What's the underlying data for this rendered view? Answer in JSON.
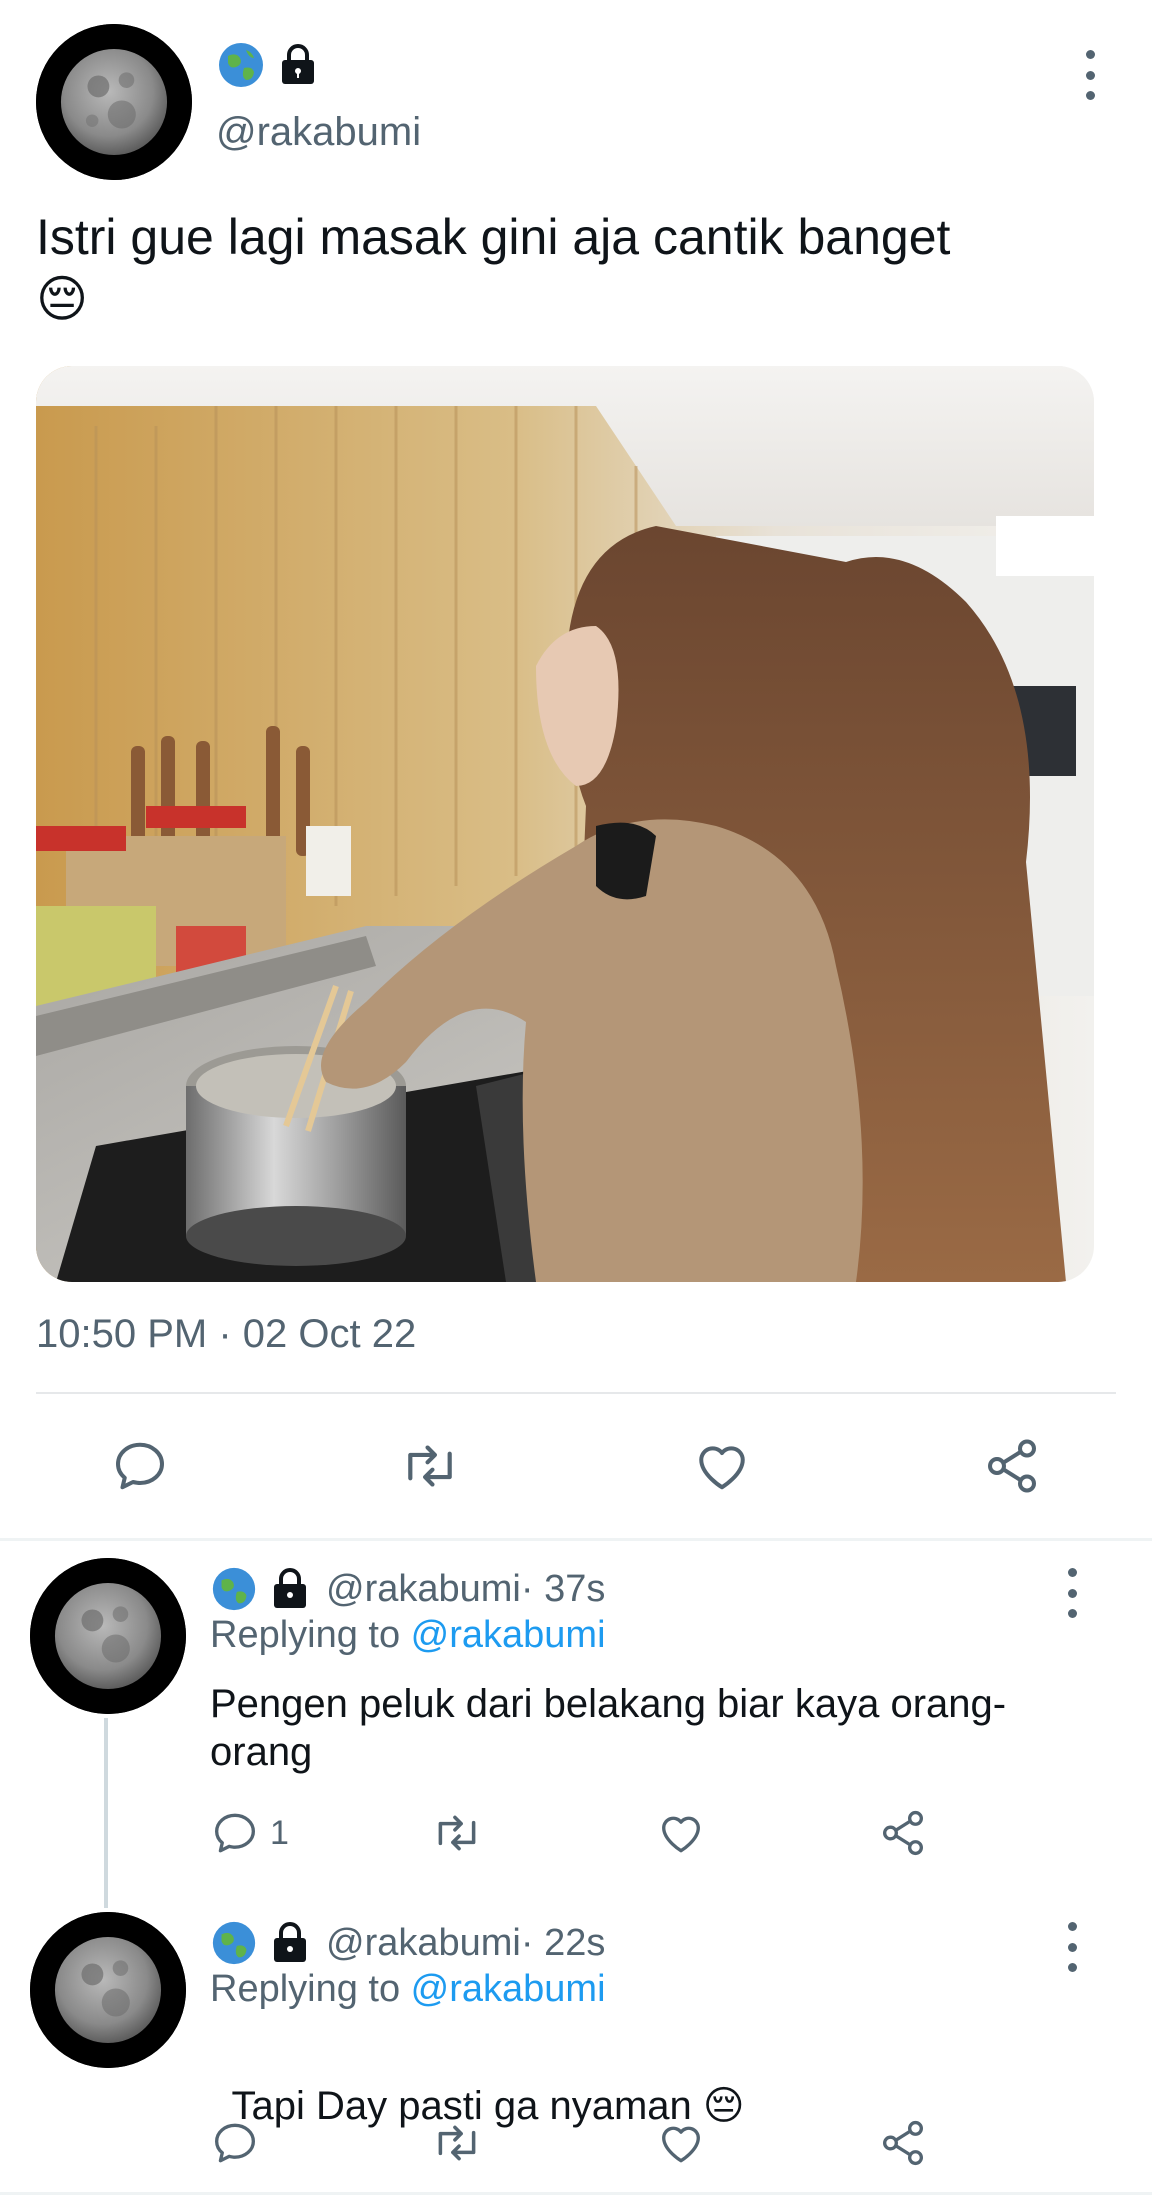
{
  "main_tweet": {
    "badges": [
      "globe-icon",
      "lock-icon"
    ],
    "handle": "@rakabumi",
    "text_line1": "Istri gue lagi masak gini aja cantik banget",
    "emoji": "😔",
    "timestamp": "10:50 PM · 02 Oct 22"
  },
  "replies": [
    {
      "handle": "@rakabumi",
      "time": " · 37s",
      "replying_prefix": "Replying to ",
      "replying_to": "@rakabumi",
      "text_line1": "Pengen peluk dari belakang biar kaya orang-",
      "text_line2": "orang",
      "reply_count": "1"
    },
    {
      "handle": "@rakabumi",
      "time": " · 22s",
      "replying_prefix": "Replying to ",
      "replying_to": "@rakabumi",
      "text": "Tapi Day pasti ga nyaman ",
      "emoji": "😔"
    }
  ],
  "colors": {
    "accent": "#1d9bf0",
    "secondary_text": "#536471",
    "primary_text": "#0f1419"
  }
}
